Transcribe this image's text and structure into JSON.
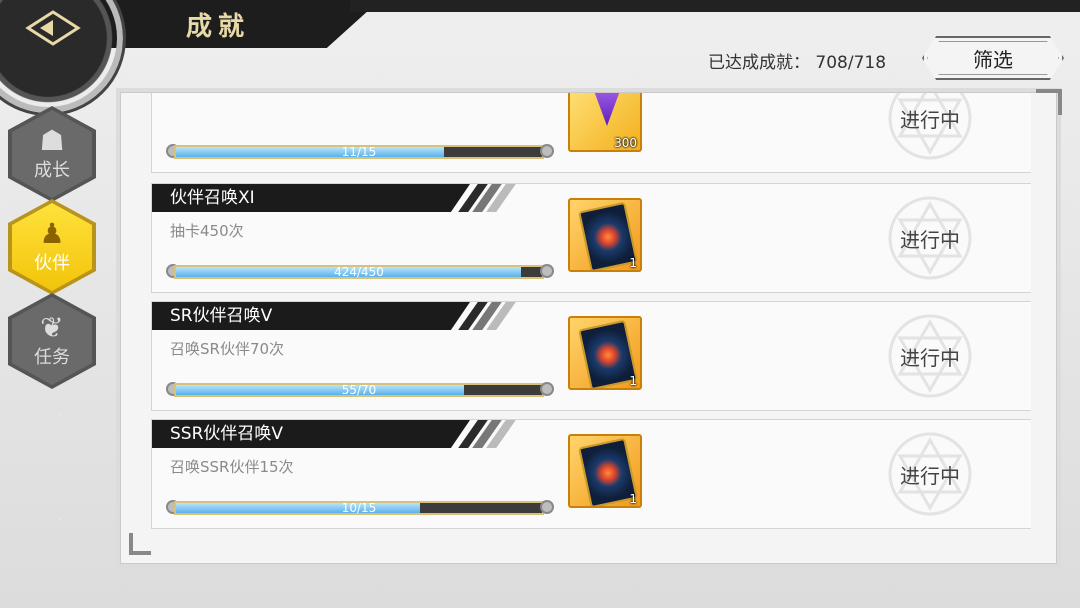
{
  "header": {
    "title": "成就",
    "progress_label": "已达成成就：",
    "progress_value": "708/718",
    "filter_label": "筛选"
  },
  "sidebar": {
    "items": [
      {
        "label": "成长",
        "icon": "mask-icon",
        "active": false
      },
      {
        "label": "伙伴",
        "icon": "companion-icon",
        "active": true
      },
      {
        "label": "任务",
        "icon": "book-icon",
        "active": false
      }
    ]
  },
  "achievements": [
    {
      "title": "",
      "desc": "",
      "progress": "11/15",
      "fraction": 0.733,
      "reward_type": "crystal",
      "reward_qty": "300",
      "status": "进行中"
    },
    {
      "title": "伙伴召唤XI",
      "desc": "抽卡450次",
      "progress": "424/450",
      "fraction": 0.942,
      "reward_type": "summon-card",
      "reward_qty": "1",
      "status": "进行中"
    },
    {
      "title": "SR伙伴召唤V",
      "desc": "召唤SR伙伴70次",
      "progress": "55/70",
      "fraction": 0.786,
      "reward_type": "summon-card",
      "reward_qty": "1",
      "status": "进行中"
    },
    {
      "title": "SSR伙伴召唤V",
      "desc": "召唤SSR伙伴15次",
      "progress": "10/15",
      "fraction": 0.667,
      "reward_type": "summon-card",
      "reward_qty": "1",
      "status": "进行中"
    }
  ],
  "colors": {
    "accent_gold": "#f2c40b",
    "bar_fill": "#5bb2ea",
    "dark": "#1b1b1b"
  }
}
